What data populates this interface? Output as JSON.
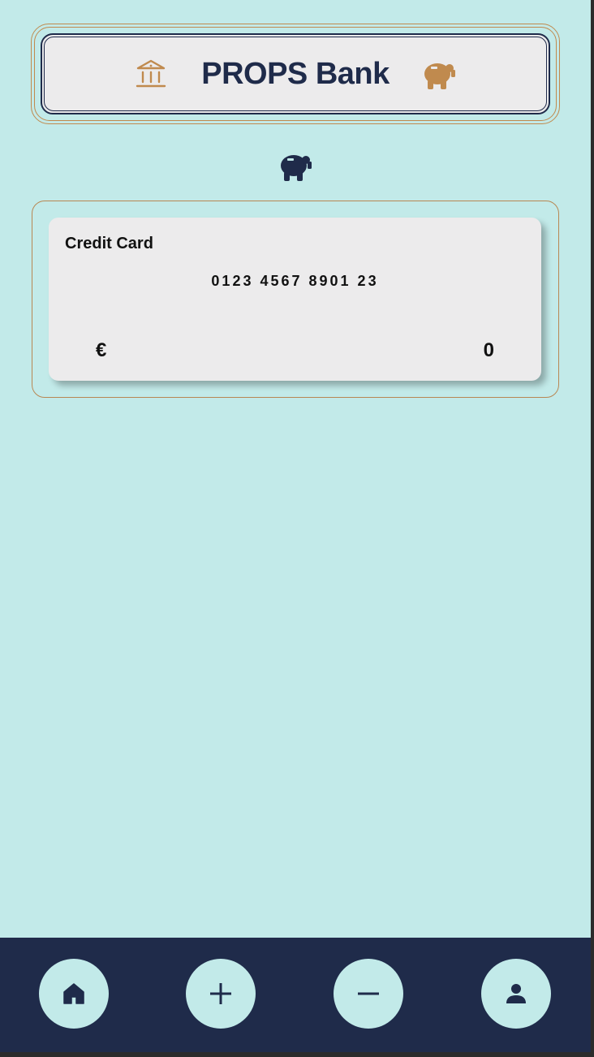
{
  "header": {
    "title": "PROPS Bank",
    "bank_icon": "bank-icon",
    "pig_icon": "piggy-bank-icon"
  },
  "section_icon": "piggy-bank-icon",
  "card": {
    "type_label": "Credit Card",
    "number": "0123 4567 8901 23",
    "currency": "€",
    "balance": "0"
  },
  "bottom_nav": {
    "items": [
      {
        "icon": "home-icon"
      },
      {
        "icon": "plus-icon"
      },
      {
        "icon": "minus-icon"
      },
      {
        "icon": "person-icon"
      }
    ]
  },
  "colors": {
    "background": "#c2eae9",
    "navy": "#1f2b4a",
    "accent": "#c08a4e",
    "card": "#ecebec"
  }
}
